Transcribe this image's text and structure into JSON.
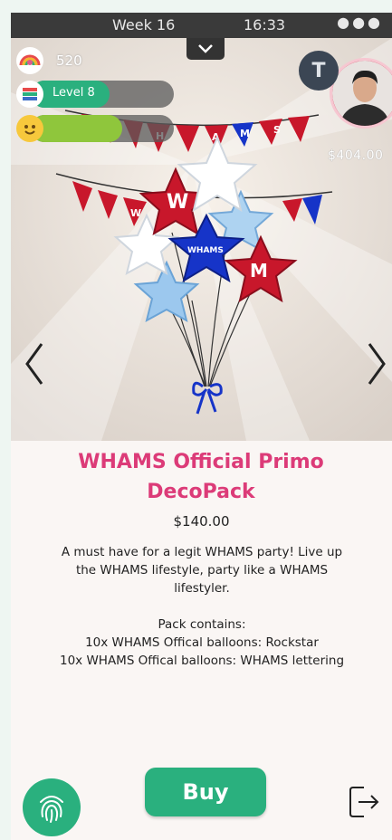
{
  "status_bar": {
    "week": "Week 16",
    "time": "16:33"
  },
  "stats": {
    "points_value": "520",
    "level_label": "Level 8",
    "level_progress": 0.55,
    "mood_progress": 0.64
  },
  "profile": {
    "badge_letter": "T",
    "balance": "$404.00"
  },
  "product": {
    "title_line1": "WHAMS Official Primo",
    "title_line2": "DecoPack",
    "price": "$140.00",
    "description": "A must have for a legit WHAMS party! Live up\nthe WHAMS lifestyle, party like a WHAMS\nlifestyler.\n\nPack contains:\n10x WHAMS Offical balloons: Rockstar\n10x WHAMS Offical balloons: WHAMS lettering",
    "banner_letters": [
      "W",
      "H",
      "A",
      "M",
      "S",
      "W"
    ],
    "balloon_letters": [
      "W",
      "M"
    ],
    "balloon_logo": "WHAMS"
  },
  "actions": {
    "buy_label": "Buy"
  },
  "colors": {
    "accent_green": "#2ab07e",
    "title_pink": "#dc3b78",
    "balloon_red": "#c8172b",
    "balloon_blue": "#1634c8"
  }
}
